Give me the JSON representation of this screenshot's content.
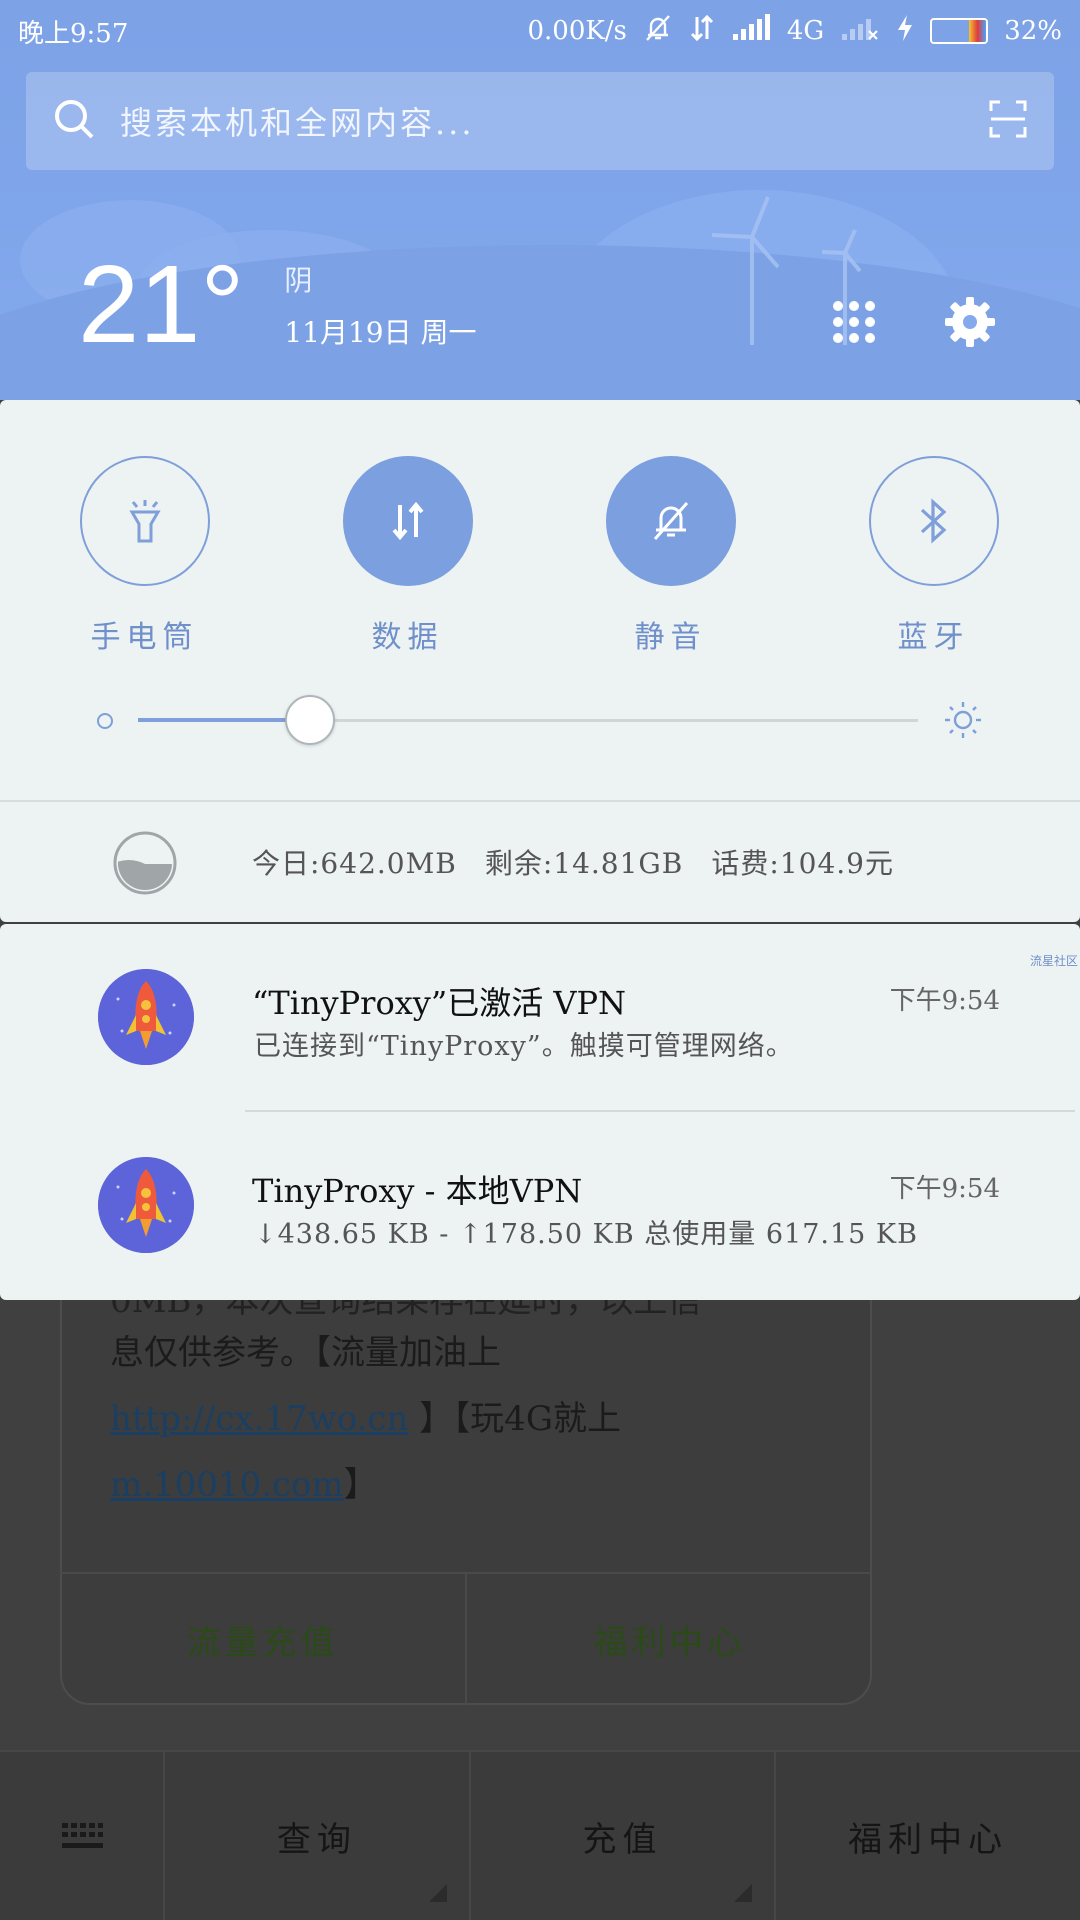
{
  "status_bar": {
    "time": "晚上9:57",
    "net_speed": "0.00K/s",
    "network_type": "4G",
    "battery": "32%",
    "battery_level": 0.32
  },
  "search": {
    "placeholder": "搜索本机和全网内容..."
  },
  "weather": {
    "temp": "21°",
    "condition": "阴",
    "date": "11月19日 周一"
  },
  "quick_toggles": [
    {
      "label": "手电筒",
      "icon": "flashlight-icon",
      "on": false
    },
    {
      "label": "数据",
      "icon": "data-arrows-icon",
      "on": true
    },
    {
      "label": "静音",
      "icon": "mute-bell-icon",
      "on": true
    },
    {
      "label": "蓝牙",
      "icon": "bluetooth-icon",
      "on": false
    }
  ],
  "brightness": {
    "level": 0.22
  },
  "data_usage": {
    "today": "今日:642.0MB",
    "remaining": "剩余:14.81GB",
    "balance": "话费:104.9元"
  },
  "notifications": [
    {
      "title": "“TinyProxy”已激活 VPN",
      "body": "已连接到“TinyProxy”。触摸可管理网络。",
      "time": "下午9:54"
    },
    {
      "title": "TinyProxy - 本地VPN",
      "body": "↓438.65 KB - ↑178.50 KB 总使用量 617.15 KB",
      "time": "下午9:54"
    }
  ],
  "watermark": "流星社区",
  "background_app": {
    "message_top": "0MB，本次查询结果存在延时，以上信",
    "message_line1": "息仅供参考。【流量加油上 ",
    "link1": "http://cx.17wo.cn",
    "message_line2": " 】【玩4G就上 ",
    "link2": "m.10010.com",
    "message_end": "】",
    "actions": [
      "流量充值",
      "福利中心"
    ],
    "bottom_tabs": [
      "查询",
      "充值",
      "福利中心"
    ]
  },
  "colors": {
    "accent": "#7b9fdf",
    "panel": "#edf2f3",
    "header": "#7fa5ea"
  }
}
